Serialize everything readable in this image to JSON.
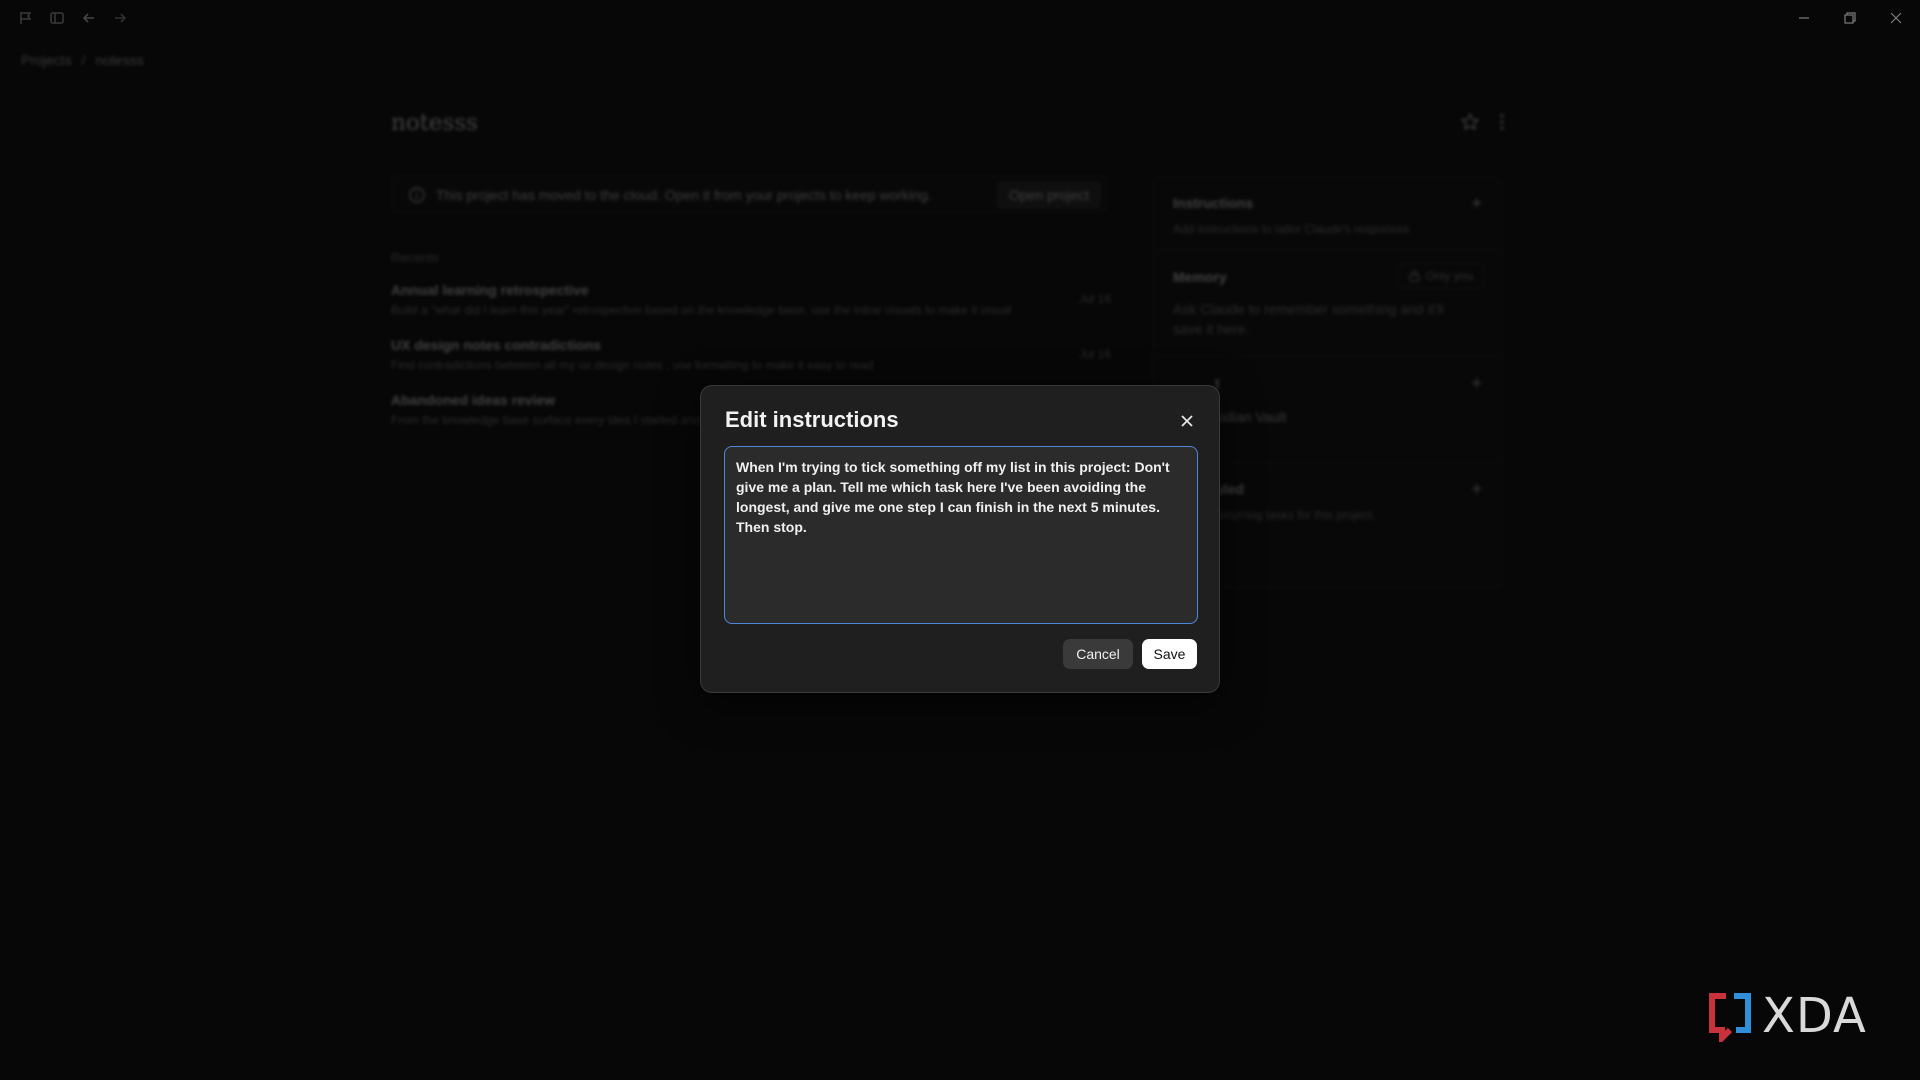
{
  "breadcrumb": {
    "root": "Projects",
    "separator": "/",
    "current": "notesss"
  },
  "page": {
    "title": "notesss"
  },
  "banner": {
    "message": "This project has moved to the cloud. Open it from your projects to keep working.",
    "button_label": "Open project"
  },
  "recents": {
    "label": "Recents",
    "items": [
      {
        "title": "Annual learning retrospective",
        "description": "Build a \"what did I learn this year\" retrospective based on the knowledge base, use the inline visuals to make it visual",
        "date": "Jul 16"
      },
      {
        "title": "UX design notes contradictions",
        "description": "Find contradictions between all my ux design notes , use formatting to make it easy to read",
        "date": "Jul 16"
      },
      {
        "title": "Abandoned ideas review",
        "description": "From the knowledge base surface every idea I started and",
        "date": ""
      }
    ]
  },
  "side_panel": {
    "instructions": {
      "title": "Instructions",
      "description": "Add instructions to tailor Claude's responses"
    },
    "memory": {
      "title": "Memory",
      "badge": "Only you",
      "description": "Ask Claude to remember something and it'll save it here."
    },
    "context": {
      "title": "t",
      "item": "sidian Vault"
    },
    "scheduled": {
      "title": "uled",
      "description": "recurring tasks for this project."
    }
  },
  "modal": {
    "title": "Edit instructions",
    "text": "When I'm trying to tick something off my list in this project: Don't give me a plan. Tell me which task here I've been avoiding the longest, and give me one step I can finish in the next 5 minutes. Then stop.",
    "cancel_label": "Cancel",
    "save_label": "Save"
  },
  "watermark": {
    "text": "XDA"
  },
  "colors": {
    "accent_focus": "#4f86d8",
    "modal_bg": "#1f1f1f",
    "save_bg": "#ffffff",
    "watermark_red": "#c8323c",
    "watermark_blue": "#2f8fd8"
  },
  "icons": [
    "sidebar-toggle-icon",
    "panel-icon",
    "back-arrow-icon",
    "forward-arrow-icon",
    "minimize-icon",
    "maximize-icon",
    "close-window-icon",
    "info-icon",
    "star-icon",
    "more-vertical-icon",
    "plus-icon",
    "lock-icon",
    "close-icon"
  ]
}
